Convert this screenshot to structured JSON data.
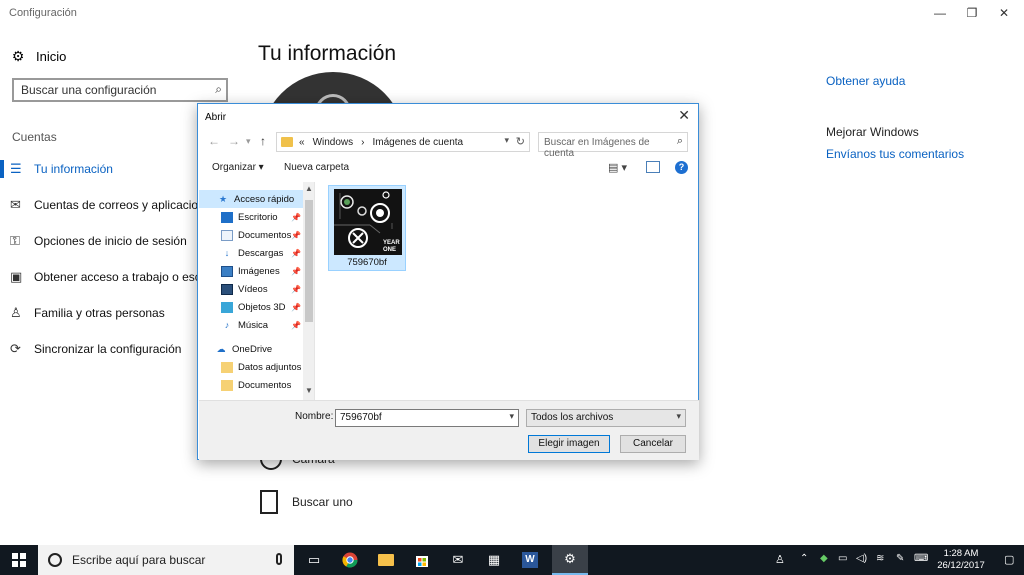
{
  "window": {
    "title": "Configuración"
  },
  "sidebar": {
    "home": "Inicio",
    "search_placeholder": "Buscar una configuración",
    "section": "Cuentas",
    "items": [
      {
        "label": "Tu información",
        "active": true
      },
      {
        "label": "Cuentas de correos y aplicaciones"
      },
      {
        "label": "Opciones de inicio de sesión"
      },
      {
        "label": "Obtener acceso a trabajo o escuela"
      },
      {
        "label": "Familia y otras personas"
      },
      {
        "label": "Sincronizar la configuración"
      }
    ]
  },
  "main": {
    "title": "Tu información",
    "camera_label": "Cámara",
    "browse_label": "Buscar uno"
  },
  "right": {
    "help_link": "Obtener ayuda",
    "improve_title": "Mejorar Windows",
    "feedback_link": "Envíanos tus comentarios"
  },
  "dialog": {
    "title": "Abrir",
    "breadcrumb": [
      "«",
      "Windows",
      "›",
      "Imágenes de cuenta"
    ],
    "search_placeholder": "Buscar en Imágenes de cuenta",
    "organize": "Organizar ▾",
    "new_folder": "Nueva carpeta",
    "nav": [
      {
        "label": "Acceso rápido",
        "icon": "star-icon",
        "selected": true
      },
      {
        "label": "Escritorio",
        "icon": "desktop-icon",
        "pinned": true
      },
      {
        "label": "Documentos",
        "icon": "documents-icon",
        "pinned": true
      },
      {
        "label": "Descargas",
        "icon": "downloads-icon",
        "pinned": true
      },
      {
        "label": "Imágenes",
        "icon": "pictures-icon",
        "pinned": true
      },
      {
        "label": "Vídeos",
        "icon": "videos-icon",
        "pinned": true
      },
      {
        "label": "Objetos 3D",
        "icon": "objects3d-icon",
        "pinned": true
      },
      {
        "label": "Música",
        "icon": "music-icon",
        "pinned": true
      },
      {
        "label": "OneDrive",
        "icon": "cloud-icon"
      },
      {
        "label": "Datos adjuntos de",
        "icon": "folder-icon"
      },
      {
        "label": "Documentos",
        "icon": "folder-icon"
      }
    ],
    "file": {
      "name": "759670bf",
      "thumb_text": [
        "YEAR",
        "ONE"
      ]
    },
    "filename_label": "Nombre:",
    "filename_value": "759670bf",
    "filetype": "Todos los archivos",
    "ok_button": "Elegir imagen",
    "cancel_button": "Cancelar"
  },
  "taskbar": {
    "search_placeholder": "Escribe aquí para buscar",
    "time": "1:28 AM",
    "date": "26/12/2017"
  },
  "colors": {
    "accent": "#0a62c2",
    "taskbar": "#111820",
    "selection": "#cce8ff"
  }
}
